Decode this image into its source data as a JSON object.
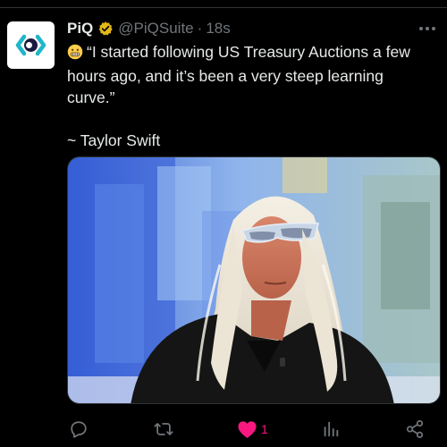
{
  "tweet": {
    "display_name": "PiQ",
    "handle": "@PiQSuite",
    "separator": "·",
    "time": "18s",
    "verified": true,
    "verified_icon": "verified-badge-icon",
    "avatar_icon": "piq-logo-icon",
    "text_emoji": "grimacing-face-emoji",
    "text_quote": "“I started following US Treasury Auctions a few hours ago, and it’s been a very steep learning curve.”",
    "attribution": "~ Taylor Swift",
    "media": {
      "kind": "photo",
      "description_icon": "news-studio-photo"
    }
  },
  "actions": {
    "reply_icon": "reply-icon",
    "retweet_icon": "retweet-icon",
    "like_icon": "heart-filled-icon",
    "like_count": "1",
    "views_icon": "views-chart-icon",
    "share_icon": "share-icon"
  },
  "colors": {
    "background": "#000000",
    "text": "#e7e9ea",
    "muted": "#71767b",
    "like": "#f91880",
    "verified": "#e2b719",
    "brand_cyan": "#1fb6c9",
    "brand_navy": "#1a1a3e"
  }
}
